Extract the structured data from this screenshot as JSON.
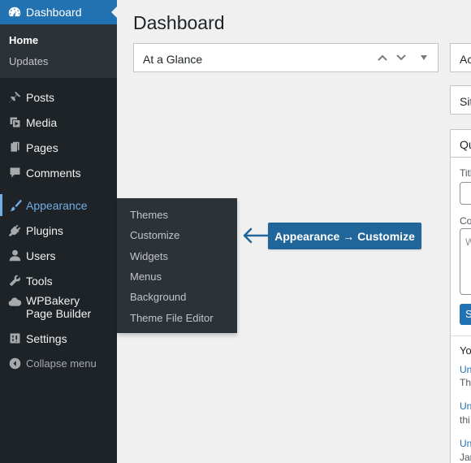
{
  "sidebar": {
    "dashboard_label": "Dashboard",
    "home_label": "Home",
    "updates_label": "Updates",
    "items": [
      {
        "label": "Posts",
        "icon": "pin-icon"
      },
      {
        "label": "Media",
        "icon": "media-icon"
      },
      {
        "label": "Pages",
        "icon": "pages-icon"
      },
      {
        "label": "Comments",
        "icon": "comment-icon"
      },
      {
        "label": "Appearance",
        "icon": "brush-icon"
      },
      {
        "label": "Plugins",
        "icon": "plug-icon"
      },
      {
        "label": "Users",
        "icon": "user-icon"
      },
      {
        "label": "Tools",
        "icon": "wrench-icon"
      },
      {
        "label": "WPBakery Page Builder",
        "icon": "cloud-icon"
      },
      {
        "label": "Settings",
        "icon": "sliders-icon"
      }
    ],
    "collapse_label": "Collapse menu"
  },
  "flyout": {
    "items": [
      "Themes",
      "Customize",
      "Widgets",
      "Menus",
      "Background",
      "Theme File Editor"
    ]
  },
  "main": {
    "title": "Dashboard",
    "glance_title": "At a Glance",
    "right_boxes": [
      "Ac",
      "Sit"
    ],
    "quick_draft": {
      "title": "Qu",
      "title_label": "Title",
      "content_label": "Co",
      "content_placeholder": "W",
      "save_label": "S",
      "your_label": "Yo",
      "drafts": [
        {
          "link": "Un",
          "text": "Thi"
        },
        {
          "link": "Un",
          "text": "thi"
        },
        {
          "link": "Un",
          "text": "Jar"
        }
      ]
    }
  },
  "callout": {
    "text": "Appearance → Customize"
  },
  "colors": {
    "sidebar_bg": "#1d2327",
    "active_bg": "#2271b1",
    "hover_text": "#72aee6",
    "callout_bg": "#21669a"
  }
}
